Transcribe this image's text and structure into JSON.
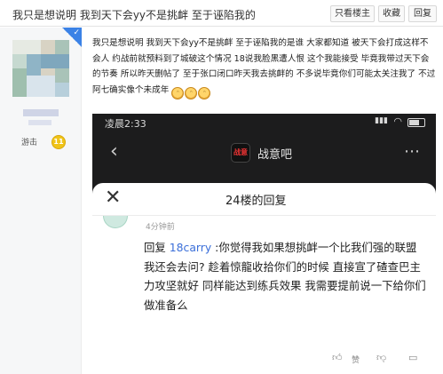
{
  "title_bar": {
    "title": "我只是想说明 我到天下会yy不是挑衅 至于诬陷我的",
    "only_op_label": "只看楼主",
    "favorite_label": "收藏",
    "reply_label": "回复"
  },
  "author": {
    "level_title": "游击",
    "level_number": "11",
    "badge_icon": "verified-corner-icon"
  },
  "post": {
    "text": "我只是想说明 我到天下会yy不是挑衅 至于诬陷我的是谁 大家都知道 被天下会打成这样不会人 约战前就预料到了城破这个情况 18说我脸黑遭人恨 这个我能接受 毕竟我带过天下会的节奏 所以昨天删帖了 至于张口闭口昨天我去挑衅的 不多说毕竟你们可能太关注我了 不过阿七确实像个未成年",
    "emoji_count_icon": "grin-emoji-icon"
  },
  "screenshot": {
    "status_time": "凌晨2:33",
    "forum_name": "战意吧",
    "forum_logo_text": "战意",
    "sheet_title": "24楼的回复",
    "reply_time": "4分钟前",
    "reply_prefix": "回复 ",
    "reply_user": "18carry",
    "reply_body": " :你觉得我如果想挑衅一个比我们强的联盟 我还会去问? 趁着惊龍收拾你们的时候 直接宣了碴查巴主力攻坚就好 同样能达到练兵效果 我需要提前说一下给你们做准备么",
    "like_label": "赞"
  },
  "colors": {
    "link_blue": "#3b6fd9",
    "badge_gold": "#f0c419",
    "corner_blue": "#3b82e6"
  }
}
